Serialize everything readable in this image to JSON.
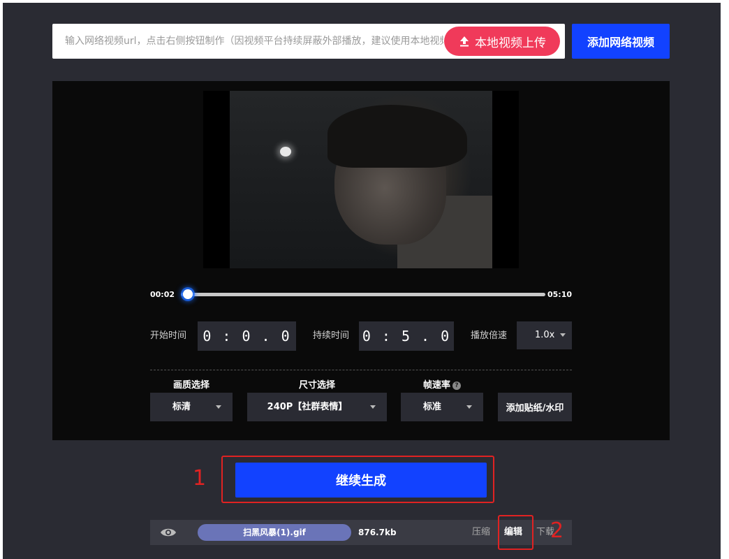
{
  "top": {
    "url_placeholder": "输入网络视频url，点击右侧按钮制作（因视频平台持续屏蔽外部播放，建议使用本地视频上传）",
    "upload_label": "本地视频上传",
    "add_net_label": "添加网络视频"
  },
  "player": {
    "current_time": "00:02",
    "total_time": "05:10",
    "progress": 0.0065
  },
  "params": {
    "start_label": "开始时间",
    "start_value": "0 : 0 . 0",
    "duration_label": "持续时间",
    "duration_value": "0 : 5 . 0",
    "speed_label": "播放倍速",
    "speed_value": "1.0x"
  },
  "options": {
    "quality_label": "画质选择",
    "quality_value": "标清",
    "size_label": "尺寸选择",
    "size_value": "240P【社群表情】",
    "fps_label": "帧速率",
    "fps_help": "?",
    "fps_value": "标准",
    "sticker_label": "添加贴纸/水印"
  },
  "generate": {
    "label": "继续生成",
    "step1": "1",
    "step2": "2"
  },
  "result": {
    "file_name": "扫黑风暴(1).gif",
    "file_size": "876.7kb",
    "compress": "压缩",
    "edit": "编辑",
    "download": "下载"
  },
  "colors": {
    "accent_blue": "#1242ff",
    "upload_pink": "#f03a5a",
    "highlight_red": "#e02222"
  }
}
